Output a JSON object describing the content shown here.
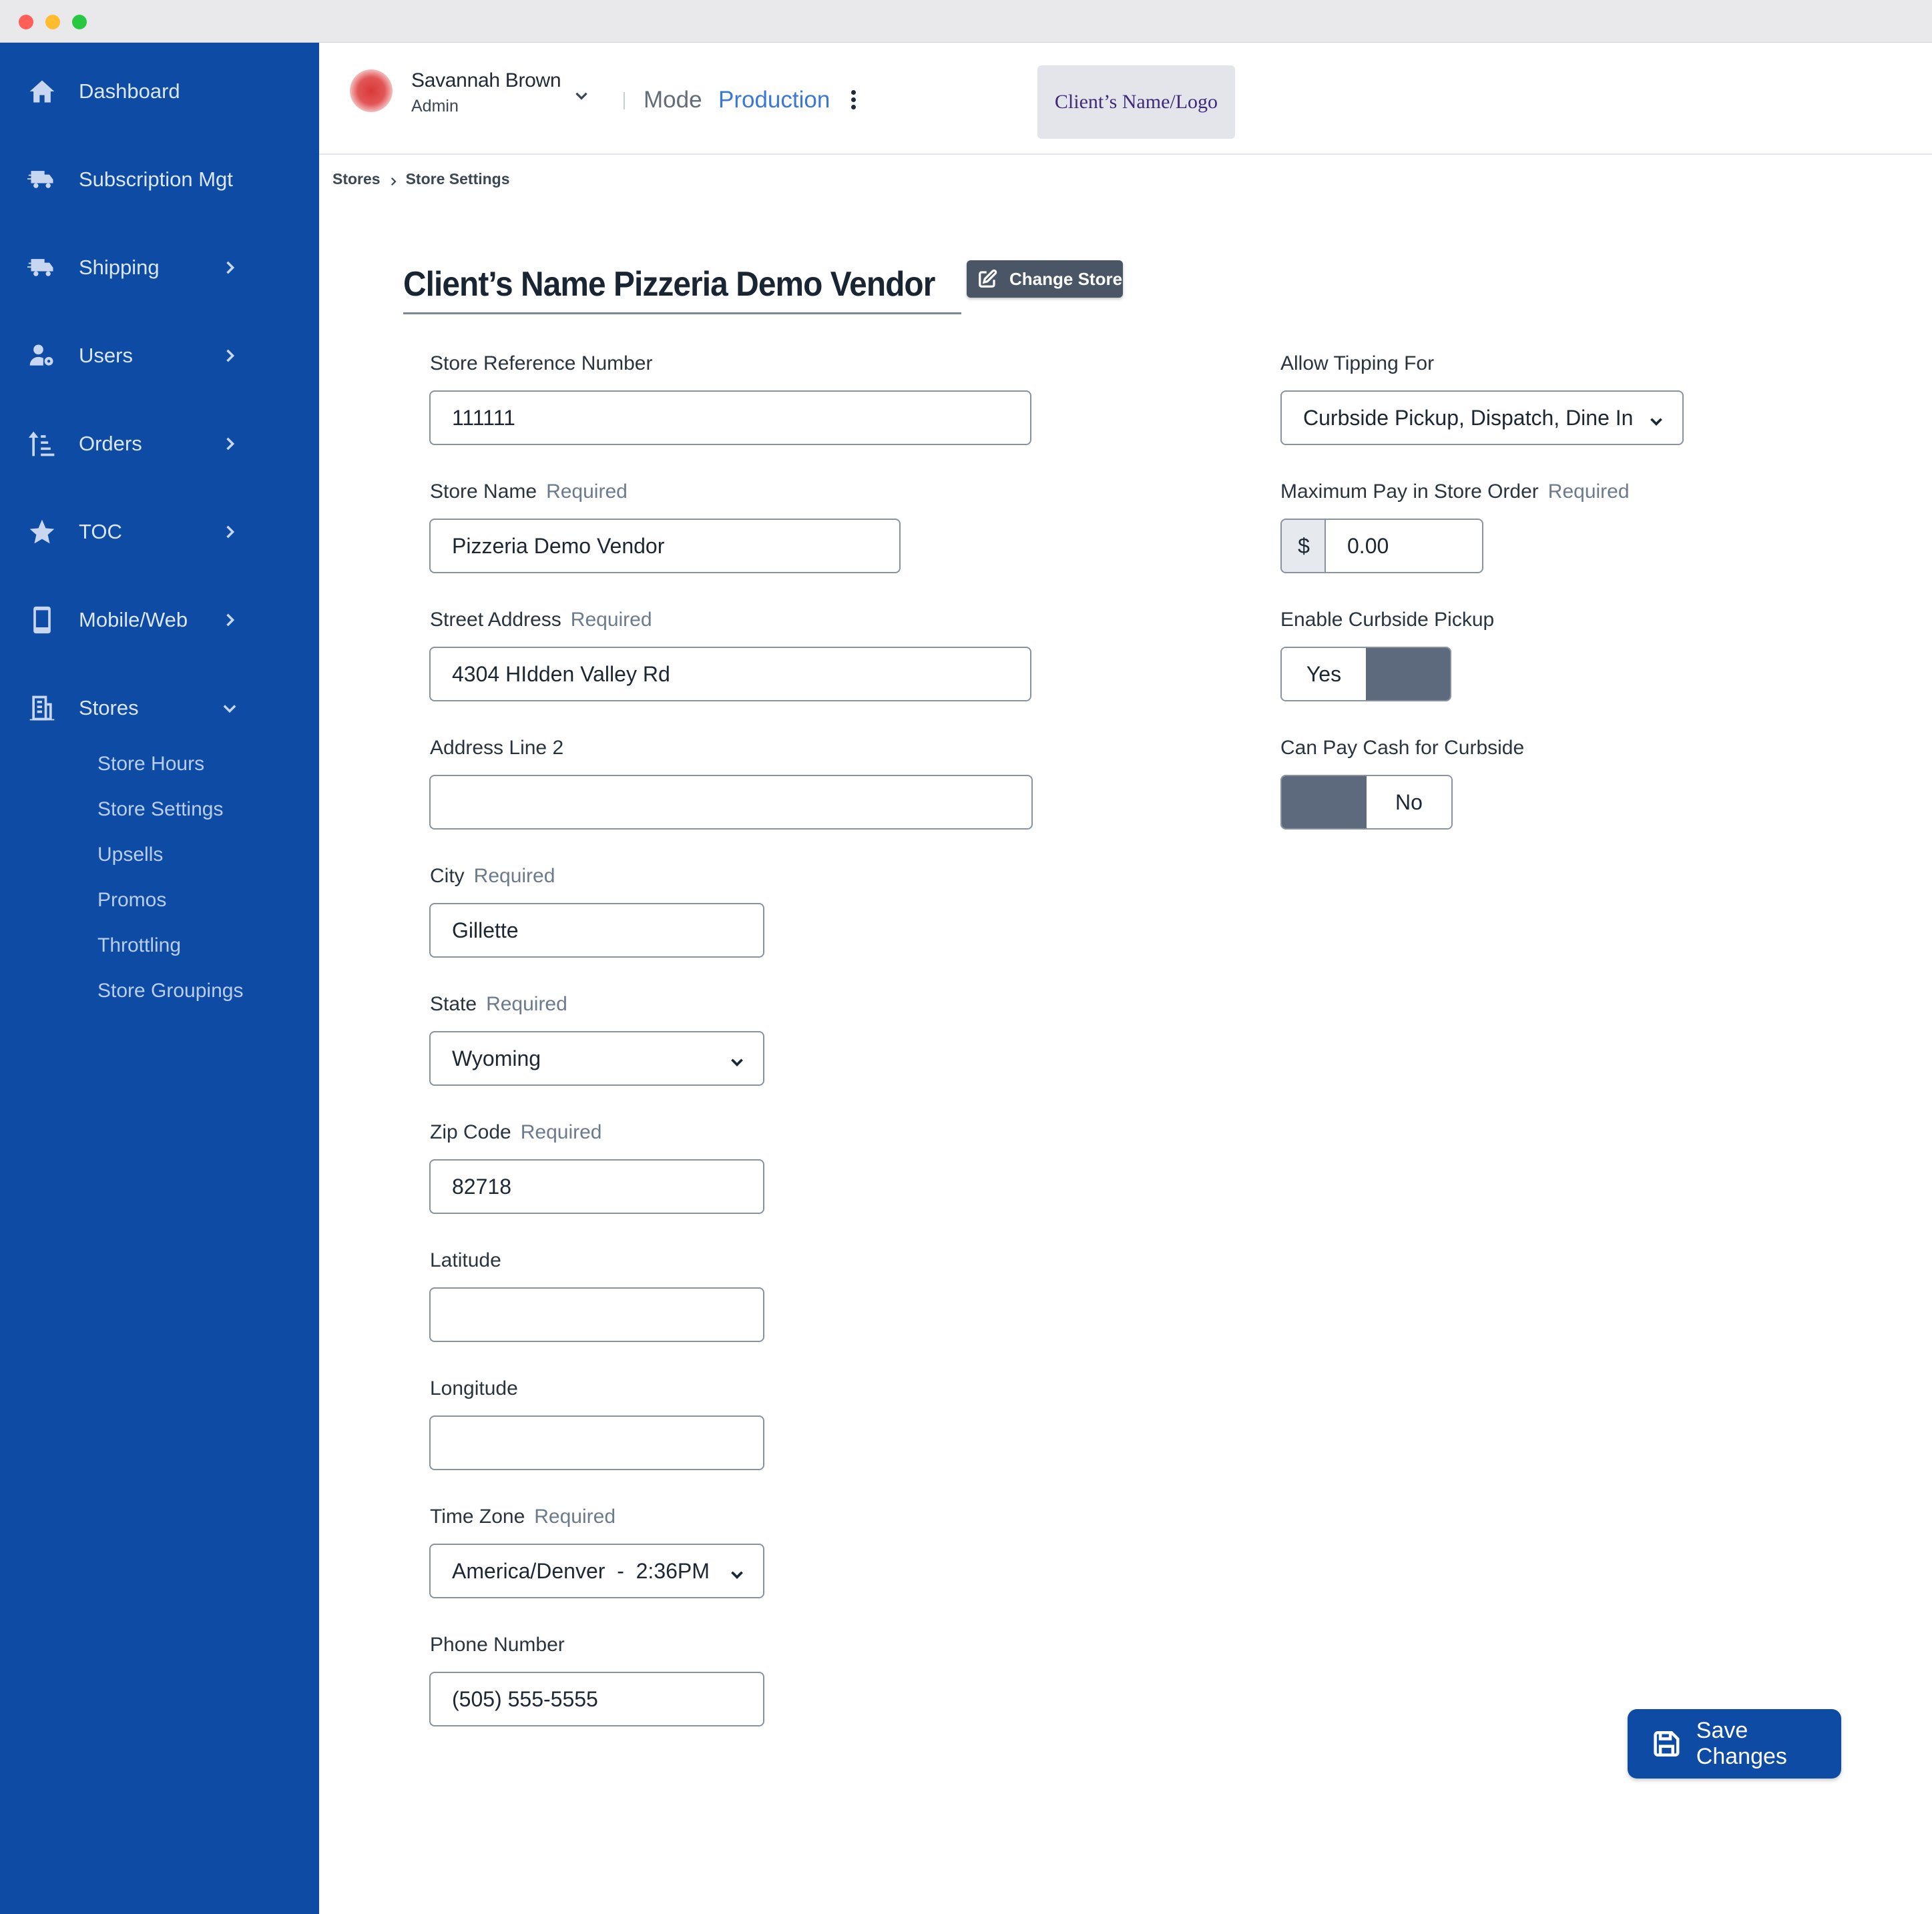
{
  "sidebar": {
    "items": [
      {
        "label": "Dashboard",
        "icon": "home-icon"
      },
      {
        "label": "Subscription Mgt",
        "icon": "delivery-truck-icon"
      },
      {
        "label": "Shipping",
        "icon": "delivery-truck-icon"
      },
      {
        "label": "Users",
        "icon": "user-gear-icon"
      },
      {
        "label": "Orders",
        "icon": "sort-list-icon"
      },
      {
        "label": "TOC",
        "icon": "star-icon"
      },
      {
        "label": "Mobile/Web",
        "icon": "mobile-phone-icon"
      },
      {
        "label": "Stores",
        "icon": "building-icon"
      }
    ],
    "stores_subitems": [
      "Store Hours",
      "Store Settings",
      "Upsells",
      "Promos",
      "Throttling",
      "Store Groupings"
    ]
  },
  "header": {
    "user_name": "Savannah Brown",
    "user_role": "Admin",
    "mode_label": "Mode",
    "mode_value": "Production",
    "client_logo_text": "Client’s Name/Logo"
  },
  "breadcrumb": [
    "Stores",
    "Store Settings"
  ],
  "page": {
    "title": "Client’s Name Pizzeria Demo Vendor",
    "change_store_label": "Change Store"
  },
  "form": {
    "required_label": "Required",
    "store_reference_number": {
      "label": "Store Reference Number",
      "value": "111111"
    },
    "store_name": {
      "label": "Store Name",
      "value": "Pizzeria Demo Vendor"
    },
    "street_address": {
      "label": "Street Address",
      "value": "4304 HIdden Valley Rd"
    },
    "address_line_2": {
      "label": "Address Line 2",
      "value": ""
    },
    "city": {
      "label": "City",
      "value": "Gillette"
    },
    "state": {
      "label": "State",
      "value": "Wyoming"
    },
    "zip_code": {
      "label": "Zip Code",
      "value": "82718"
    },
    "latitude": {
      "label": "Latitude",
      "value": ""
    },
    "longitude": {
      "label": "Longitude",
      "value": ""
    },
    "time_zone": {
      "label": "Time Zone",
      "value": "America/Denver  -  2:36PM"
    },
    "phone_number": {
      "label": "Phone Number",
      "value": "(505) 555-5555"
    },
    "allow_tipping_for": {
      "label": "Allow Tipping For",
      "value": "Curbside Pickup, Dispatch, Dine In"
    },
    "max_pay_in_store": {
      "label": "Maximum Pay in Store Order",
      "currency": "$",
      "value": "0.00"
    },
    "enable_curbside_pickup": {
      "label": "Enable Curbside Pickup",
      "value": "Yes"
    },
    "can_pay_cash_curbside": {
      "label": "Can Pay Cash for Curbside",
      "value": "No"
    }
  },
  "actions": {
    "save_label": "Save Changes"
  },
  "colors": {
    "sidebar_bg": "#0e4ba4",
    "accent": "#3a78d8",
    "toggle_knob": "#5d6a7d",
    "save_button": "#0e4ba4"
  }
}
